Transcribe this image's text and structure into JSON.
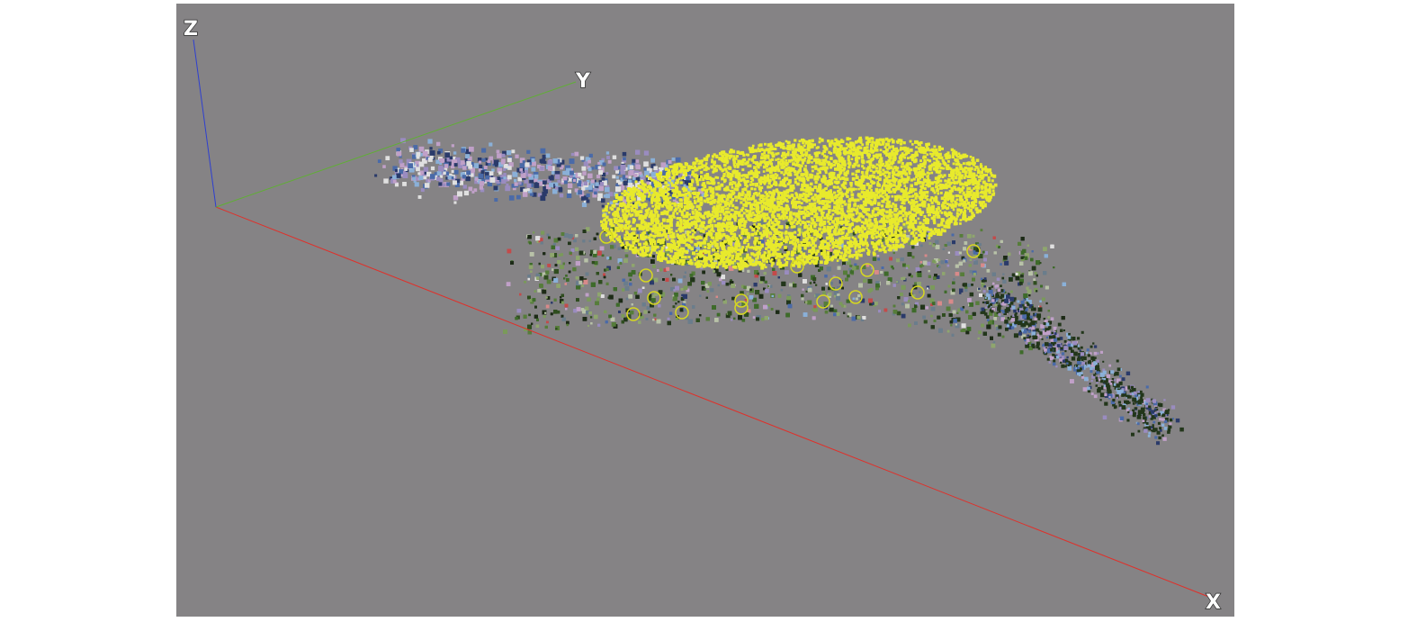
{
  "viewer": {
    "background_color": "#858385",
    "axes": {
      "x": {
        "label": "X",
        "color": "#e0302a"
      },
      "y": {
        "label": "Y",
        "color": "#5fb032"
      },
      "z": {
        "label": "Z",
        "color": "#2e3fd0"
      }
    },
    "point_cloud": {
      "highlighted_color": "#e8ea2c",
      "marker_color": "#d7d81f",
      "palette": [
        "#2f4d1f",
        "#3e6b2a",
        "#22361a",
        "#567d3a",
        "#7a9a5a",
        "#1c2a16",
        "#8fa66e",
        "#b8c2a8",
        "#6a7d8c",
        "#c44a4a",
        "#d88a8a",
        "#e0e0e0",
        "#4a6aa8",
        "#8ab0d8",
        "#2a3a6a",
        "#9a8cc0",
        "#c0a0c8"
      ]
    }
  }
}
